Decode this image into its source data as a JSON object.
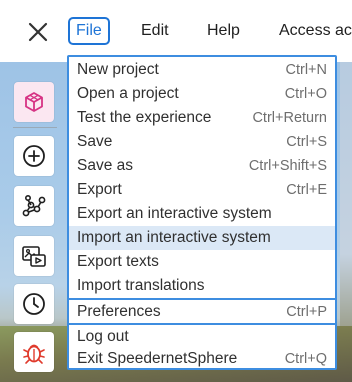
{
  "menubar": {
    "close_icon": "close-icon",
    "tabs": [
      {
        "label": "File",
        "active": true
      },
      {
        "label": "Edit",
        "active": false
      },
      {
        "label": "Help",
        "active": false
      },
      {
        "label": "Access ac",
        "active": false
      }
    ]
  },
  "toolrail": {
    "tools": [
      {
        "icon": "cube-icon",
        "color": "#d63384"
      },
      {
        "icon": "plus-circle-icon",
        "color": "#1f1f1f"
      },
      {
        "icon": "graph-nodes-icon",
        "color": "#1f1f1f"
      },
      {
        "icon": "media-icon",
        "color": "#1f1f1f"
      },
      {
        "icon": "clock-icon",
        "color": "#1f1f1f"
      },
      {
        "icon": "bug-icon",
        "color": "#e03b2d"
      }
    ]
  },
  "file_menu": {
    "hovered_index": 7,
    "groups": [
      [
        {
          "label": "New project",
          "shortcut": "Ctrl+N"
        },
        {
          "label": "Open a project",
          "shortcut": "Ctrl+O"
        },
        {
          "label": "Test the experience",
          "shortcut": "Ctrl+Return"
        },
        {
          "label": "Save",
          "shortcut": "Ctrl+S"
        },
        {
          "label": "Save as",
          "shortcut": "Ctrl+Shift+S"
        },
        {
          "label": "Export",
          "shortcut": "Ctrl+E"
        },
        {
          "label": "Export an interactive system",
          "shortcut": ""
        },
        {
          "label": "Import an interactive system",
          "shortcut": ""
        },
        {
          "label": "Export texts",
          "shortcut": ""
        },
        {
          "label": "Import translations",
          "shortcut": ""
        }
      ],
      [
        {
          "label": "Preferences",
          "shortcut": "Ctrl+P"
        }
      ],
      [
        {
          "label": "Log out",
          "shortcut": ""
        },
        {
          "label": "Exit SpeedernetSphere",
          "shortcut": "Ctrl+Q"
        }
      ]
    ]
  },
  "colors": {
    "accent": "#1e74d6",
    "menu_border": "#3d8de0",
    "hover_bg": "#dbe8f6"
  }
}
